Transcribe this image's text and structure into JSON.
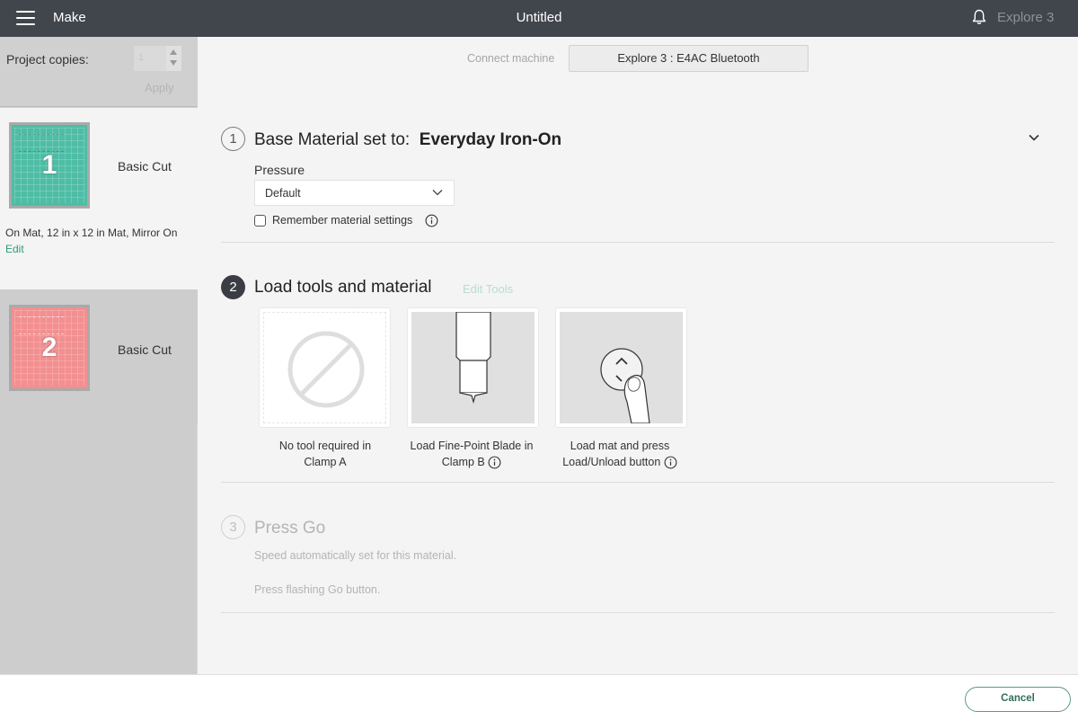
{
  "topbar": {
    "menu_icon": "hamburger-menu-icon",
    "app_title": "Make",
    "document_title": "Untitled",
    "notification_icon": "bell-icon",
    "machine_name": "Explore 3"
  },
  "sidebar": {
    "project_copies_label": "Project copies:",
    "project_copies_value": "1",
    "apply_label": "Apply",
    "mats": [
      {
        "number": "1",
        "label": "Basic Cut",
        "color": "#4fbda5",
        "selected": true,
        "info": "On Mat, 12 in x 12 in Mat, Mirror On",
        "edit_label": "Edit"
      },
      {
        "number": "2",
        "label": "Basic Cut",
        "color": "#f28f90",
        "selected": false
      }
    ]
  },
  "main": {
    "connect_label": "Connect machine",
    "machine_button": "Explore 3 : E4AC Bluetooth",
    "step1": {
      "number": "1",
      "title_prefix": "Base Material set to:",
      "material": "Everyday Iron-On",
      "pressure_label": "Pressure",
      "pressure_value": "Default",
      "remember_label": "Remember material settings",
      "remember_checked": false
    },
    "step2": {
      "number": "2",
      "title": "Load tools and material",
      "edit_tools_label": "Edit Tools",
      "tools": [
        {
          "icon": "no-tool-icon",
          "caption_line1": "No tool required in",
          "caption_line2": "Clamp A",
          "has_info": false
        },
        {
          "icon": "fine-point-blade-icon",
          "caption_line1": "Load Fine-Point Blade in",
          "caption_line2": "Clamp B",
          "has_info": true
        },
        {
          "icon": "load-unload-button-icon",
          "caption_line1": "Load mat and press",
          "caption_line2": "Load/Unload button",
          "has_info": true
        }
      ]
    },
    "step3": {
      "number": "3",
      "title": "Press Go",
      "line1": "Speed automatically set for this material.",
      "line2": "Press flashing Go button."
    }
  },
  "footer": {
    "cancel_label": "Cancel"
  },
  "colors": {
    "topbar_bg": "#41454c",
    "accent_green": "#2f9b7b",
    "mat1": "#4fbda5",
    "mat2": "#f28f90"
  }
}
